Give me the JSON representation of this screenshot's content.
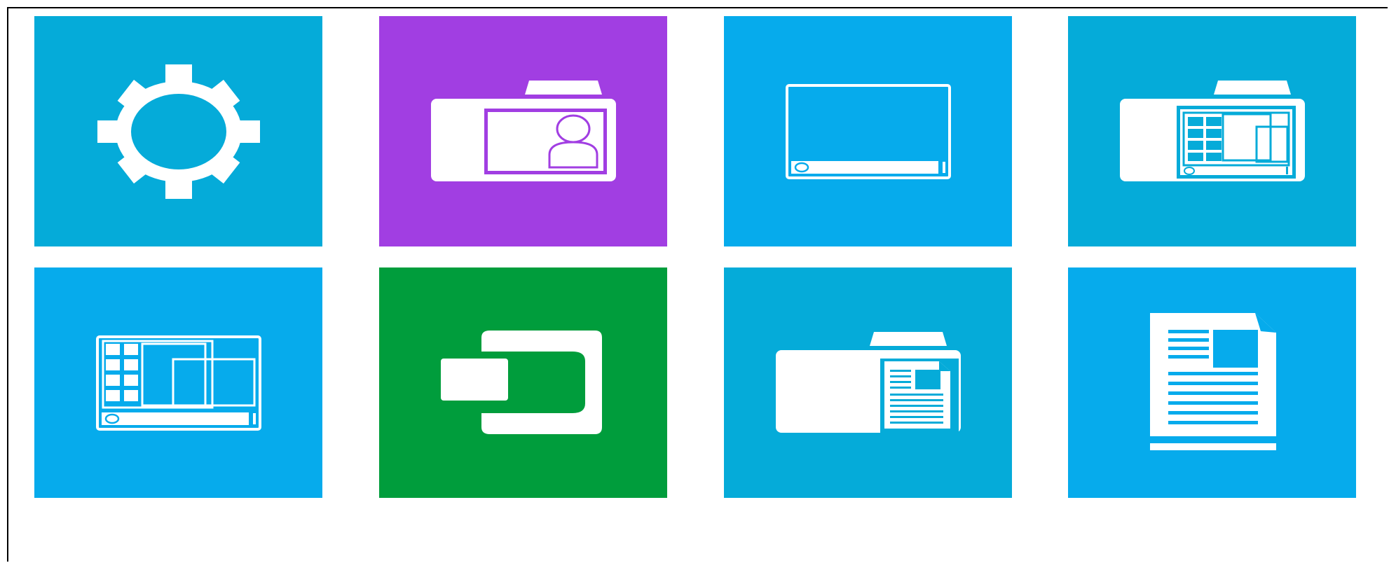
{
  "tiles": [
    {
      "id": "settings",
      "icon": "gear-icon",
      "color": "#05abd9"
    },
    {
      "id": "user-account",
      "icon": "camera-contact-card-icon",
      "color": "#a13ee2"
    },
    {
      "id": "remote-desktop",
      "icon": "desktop-window-icon",
      "color": "#06abec"
    },
    {
      "id": "remote-apps",
      "icon": "camera-windows-grid-icon",
      "color": "#05abd9"
    },
    {
      "id": "applications",
      "icon": "window-grid-layout-icon",
      "color": "#06abec"
    },
    {
      "id": "connect",
      "icon": "card-into-reader-icon",
      "color": "#009d3c"
    },
    {
      "id": "remote-documents",
      "icon": "camera-document-icon",
      "color": "#05abd9"
    },
    {
      "id": "documents",
      "icon": "document-page-icon",
      "color": "#06abec"
    }
  ]
}
